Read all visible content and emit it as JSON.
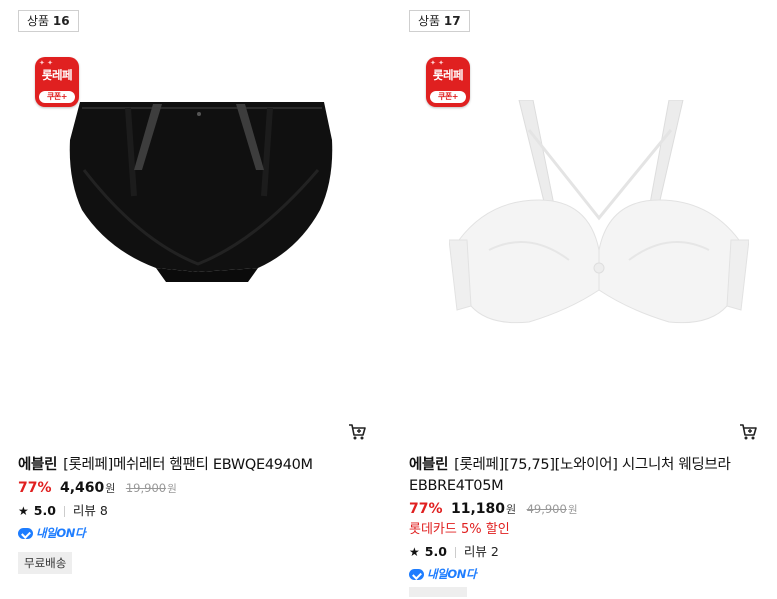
{
  "products": [
    {
      "rank_prefix": "상품",
      "rank": "16",
      "coupon_badge": {
        "title": "롯레페",
        "sub": "쿠폰+"
      },
      "brand": "에블린",
      "title": "[롯레페]메쉬레터 헴팬티 EBWQE4940M",
      "discount": "77%",
      "price": "4,460",
      "currency": "원",
      "original_price": "19,900",
      "rating": "5.0",
      "reviews": "리뷰 8",
      "delivery_label": "내일ON다",
      "free_shipping": "무료배송",
      "image_color": "#111111"
    },
    {
      "rank_prefix": "상품",
      "rank": "17",
      "coupon_badge": {
        "title": "롯레페",
        "sub": "쿠폰+"
      },
      "brand": "에블린",
      "title": "[롯레페][75,75][노와이어] 시그니처 웨딩브라 EBBRE4T05M",
      "discount": "77%",
      "price": "11,180",
      "currency": "원",
      "original_price": "49,900",
      "card_promo": "롯데카드 5% 할인",
      "rating": "5.0",
      "reviews": "리뷰 2",
      "delivery_label": "내일ON다",
      "image_color": "#f4f4f4"
    }
  ],
  "colors": {
    "accent_red": "#e02020",
    "delivery_blue": "#1e7dff"
  }
}
